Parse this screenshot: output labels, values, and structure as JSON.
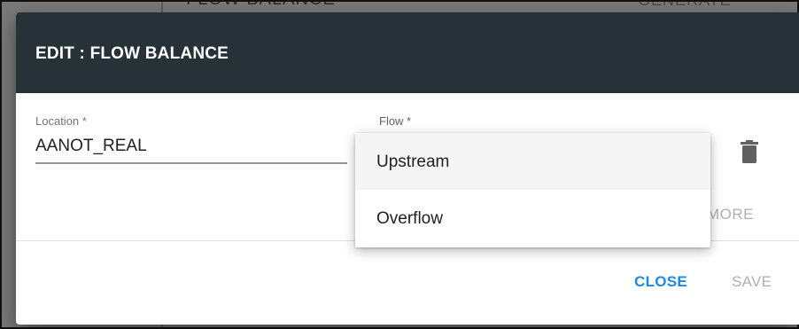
{
  "background": {
    "heading": "FLOW BALANCE",
    "report_button": "GENERATE REPORT"
  },
  "dialog": {
    "title": "EDIT : FLOW BALANCE",
    "location": {
      "label": "Location *",
      "value": "AANOT_REAL"
    },
    "flow": {
      "label": "Flow *",
      "options": [
        "Upstream",
        "Overflow"
      ],
      "highlighted": "Upstream"
    },
    "more_label": "MORE",
    "delete_icon": "trash-icon",
    "buttons": {
      "close": "CLOSE",
      "save": "SAVE"
    }
  },
  "colors": {
    "header_bg": "#263238",
    "primary": "#1e88e5",
    "disabled": "#b0b0b0"
  }
}
